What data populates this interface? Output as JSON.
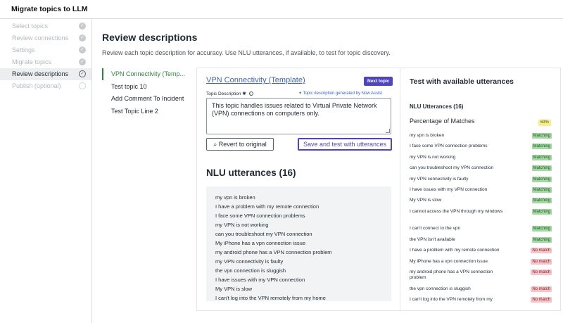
{
  "app": {
    "title": "Migrate topics to LLM"
  },
  "steps": [
    {
      "label": "Select topics",
      "state": "done"
    },
    {
      "label": "Review connections",
      "state": "done"
    },
    {
      "label": "Settings",
      "state": "done"
    },
    {
      "label": "Migrate topics",
      "state": "done"
    },
    {
      "label": "Review descriptions",
      "state": "active"
    },
    {
      "label": "Publish (optional)",
      "state": "pending"
    }
  ],
  "page": {
    "title": "Review descriptions",
    "subtitle": "Review each topic description for accuracy. Use NLU utterances, if available, to test for topic discovery."
  },
  "topics": [
    {
      "label": "VPN Connectivity (Temp...",
      "active": true
    },
    {
      "label": "Test topic 10",
      "active": false
    },
    {
      "label": "Add Comment To Incident",
      "active": false
    },
    {
      "label": "Test Topic Line 2",
      "active": false
    }
  ],
  "editor": {
    "topic_name": "VPN Connectivity (Template)",
    "next_label": "Next topic",
    "description_label": "Topic Description",
    "required_mark": "✱",
    "generated_note": "Topic description generated by Now Assist",
    "description": "This topic handles issues related to Virtual Private Network (VPN) connections on computers only.",
    "revert_label": "Revert to original",
    "save_label": "Save and test with utterances",
    "nlu_title": "NLU utterances (16)",
    "utterances": [
      "my vpn is broken",
      "I have a problem with my remote connection",
      "I face some VPN connection problems",
      "my VPN is not working",
      "can you troubleshoot my VPN connection",
      "My iPhone has a vpn connection issue",
      "my android phone has a VPN connection problem",
      "my VPN connectivity is faulty",
      "the vpn connection is sluggish",
      "I have issues with my VPN connection",
      "My VPN is slow",
      "I can't log into the VPN remotely from my home"
    ]
  },
  "test": {
    "title": "Test with available utterances",
    "nlu_count": "NLU Utterances (16)",
    "pct_label": "Percentage of Matches",
    "pct_value": "63%",
    "results": [
      {
        "text": "my vpn is broken",
        "status": "Matching"
      },
      {
        "text": "I face some VPN connection problems",
        "status": "Matching"
      },
      {
        "text": "my VPN is not working",
        "status": "Matching"
      },
      {
        "text": "can you troubleshoot my VPN connection",
        "status": "Matching"
      },
      {
        "text": "my VPN connectivity is faulty",
        "status": "Matching"
      },
      {
        "text": "I have issues with my VPN connection",
        "status": "Matching"
      },
      {
        "text": "My VPN is slow",
        "status": "Matching"
      },
      {
        "text": "I cannot access the VPN through my windows",
        "status": "Matching"
      },
      {
        "text": "I can't connect to the vpn",
        "status": "Matching"
      },
      {
        "text": "the VPN isn't available",
        "status": "Matching"
      },
      {
        "text": "I have a problem with my remote connection",
        "status": "No match"
      },
      {
        "text": "My iPhone has a vpn connection issue",
        "status": "No match"
      },
      {
        "text": "my android phone has a VPN connection problem",
        "status": "No match"
      },
      {
        "text": "the vpn connection is sluggish",
        "status": "No match"
      },
      {
        "text": "I can't log into the VPN remotely from my",
        "status": "No match"
      }
    ]
  },
  "icons": {
    "step_done": "check-circle-icon",
    "step_active": "progress-circle-icon",
    "info": "info-icon",
    "sparkle": "sparkle-icon",
    "revert": "revert-icon"
  }
}
